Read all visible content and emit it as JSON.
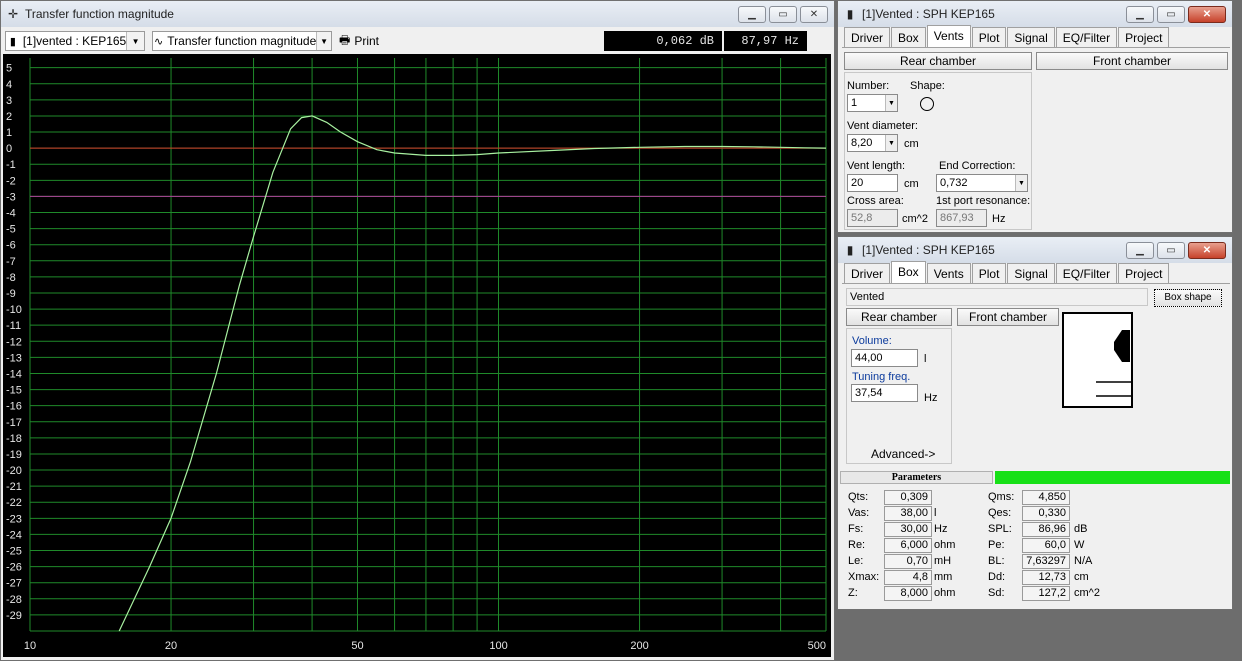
{
  "graph_window": {
    "title": "Transfer function magnitude",
    "project_combo": "[1]vented : KEP165",
    "plot_combo": "Transfer function magnitude",
    "print_label": "Print",
    "readout_db": "0,062 dB",
    "readout_hz": "87,97 Hz"
  },
  "vents_window": {
    "title": "[1]Vented : SPH KEP165",
    "tabs": [
      "Driver",
      "Box",
      "Vents",
      "Plot",
      "Signal",
      "EQ/Filter",
      "Project"
    ],
    "active_tab": "Vents",
    "rear_chamber": "Rear chamber",
    "front_chamber": "Front chamber",
    "number_label": "Number:",
    "number_value": "1",
    "shape_label": "Shape:",
    "vent_diameter_label": "Vent diameter:",
    "vent_diameter_value": "8,20",
    "vent_diameter_unit": "cm",
    "vent_length_label": "Vent length:",
    "vent_length_value": "20",
    "vent_length_unit": "cm",
    "end_correction_label": "End Correction:",
    "end_correction_value": "0,732",
    "cross_area_label": "Cross area:",
    "cross_area_value": "52,8",
    "cross_area_unit": "cm^2",
    "port_res_label": "1st port resonance:",
    "port_res_value": "867,93",
    "port_res_unit": "Hz"
  },
  "box_window": {
    "title": "[1]Vented : SPH KEP165",
    "tabs": [
      "Driver",
      "Box",
      "Vents",
      "Plot",
      "Signal",
      "EQ/Filter",
      "Project"
    ],
    "active_tab": "Box",
    "box_type": "Vented",
    "box_shape_btn": "Box shape",
    "rear_chamber": "Rear chamber",
    "front_chamber": "Front chamber",
    "volume_label": "Volume:",
    "volume_value": "44,00",
    "volume_unit": "l",
    "tuning_label": "Tuning freq.",
    "tuning_value": "37,54",
    "tuning_unit": "Hz",
    "advanced": "Advanced->"
  },
  "parameters": {
    "header": "Parameters",
    "left": [
      {
        "name": "Qts:",
        "value": "0,309",
        "unit": ""
      },
      {
        "name": "Vas:",
        "value": "38,00",
        "unit": "l"
      },
      {
        "name": "Fs:",
        "value": "30,00",
        "unit": "Hz"
      },
      {
        "name": "Re:",
        "value": "6,000",
        "unit": "ohm"
      },
      {
        "name": "Le:",
        "value": "0,70",
        "unit": "mH"
      },
      {
        "name": "Xmax:",
        "value": "4,8",
        "unit": "mm"
      },
      {
        "name": "Z:",
        "value": "8,000",
        "unit": "ohm"
      }
    ],
    "right": [
      {
        "name": "Qms:",
        "value": "4,850",
        "unit": ""
      },
      {
        "name": "Qes:",
        "value": "0,330",
        "unit": ""
      },
      {
        "name": "SPL:",
        "value": "86,96",
        "unit": "dB"
      },
      {
        "name": "Pe:",
        "value": "60,0",
        "unit": "W"
      },
      {
        "name": "BL:",
        "value": "7,63297",
        "unit": "N/A"
      },
      {
        "name": "Dd:",
        "value": "12,73",
        "unit": "cm"
      },
      {
        "name": "Sd:",
        "value": "127,2",
        "unit": "cm^2"
      }
    ]
  },
  "chart_data": {
    "type": "line",
    "xscale": "log",
    "xlim": [
      10,
      500
    ],
    "ylim": [
      -30,
      5.6
    ],
    "x_ticks": [
      10,
      20,
      50,
      100,
      200,
      500
    ],
    "x_tick_labels": [
      "10",
      "20",
      "50",
      "100",
      "200",
      "500"
    ],
    "y_tick_labels": [
      "5",
      "4",
      "3",
      "2",
      "1",
      "0",
      "-1",
      "-2",
      "-3",
      "-4",
      "-5",
      "-6",
      "-7",
      "-8",
      "-9",
      "-10",
      "-11",
      "-12",
      "-13",
      "-14",
      "-15",
      "-16",
      "-17",
      "-18",
      "-19",
      "-20",
      "-21",
      "-22",
      "-23",
      "-24",
      "-25",
      "-26",
      "-27",
      "-28",
      "-29"
    ],
    "reference_lines": [
      {
        "y": 0,
        "color": "#d23a2a"
      },
      {
        "y": -3,
        "color": "#b0409a"
      }
    ],
    "series": [
      {
        "color": "#a8f0a0",
        "x": [
          15.5,
          18,
          20,
          22,
          25,
          28,
          30,
          33,
          36,
          38,
          40,
          43,
          46,
          50,
          55,
          60,
          70,
          80,
          90,
          100,
          130,
          160,
          200,
          250,
          300,
          350,
          400,
          450,
          500
        ],
        "y": [
          -30,
          -26,
          -23,
          -19.5,
          -14,
          -8.5,
          -5.5,
          -1.5,
          1.2,
          1.9,
          2.0,
          1.6,
          1.0,
          0.4,
          -0.1,
          -0.3,
          -0.45,
          -0.45,
          -0.4,
          -0.3,
          -0.15,
          -0.02,
          0.05,
          0.1,
          0.1,
          0.08,
          0.05,
          0.02,
          0.0
        ]
      }
    ],
    "grid": true,
    "grid_color": "#1f8a2a"
  }
}
